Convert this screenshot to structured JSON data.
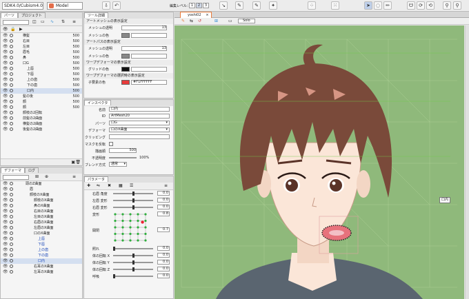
{
  "toolbar": {
    "app_select": "SDK4.0/Cubism4.0",
    "mode_select": "Model",
    "edit_level_label": "編集レベル：",
    "levels": [
      "1",
      "2",
      "3"
    ]
  },
  "left_top": {
    "tabs": [
      "パーツ",
      "プロジェクト"
    ],
    "rows": [
      {
        "label": "横髪",
        "value": "500",
        "indent": 10
      },
      {
        "label": "右目",
        "value": "500",
        "indent": 10
      },
      {
        "label": "左目",
        "value": "500",
        "indent": 10
      },
      {
        "label": "眉毛",
        "value": "500",
        "indent": 10
      },
      {
        "label": "鼻",
        "value": "500",
        "indent": 10
      },
      {
        "label": "口G",
        "value": "500",
        "indent": 10
      },
      {
        "label": "上唇",
        "value": "500",
        "indent": 16
      },
      {
        "label": "下唇",
        "value": "500",
        "indent": 16
      },
      {
        "label": "上の歯",
        "value": "500",
        "indent": 16
      },
      {
        "label": "下の歯",
        "value": "500",
        "indent": 16
      },
      {
        "label": "口内",
        "value": "500",
        "indent": 16,
        "selected": true
      },
      {
        "label": "髪の後",
        "value": "500",
        "indent": 10
      },
      {
        "label": "顔",
        "value": "500",
        "indent": 10
      },
      {
        "label": "顔",
        "value": "500",
        "indent": 10
      },
      {
        "label": "顔枝の2回転",
        "value": "",
        "indent": 10
      },
      {
        "label": "前髪の2曲面",
        "value": "",
        "indent": 10
      },
      {
        "label": "横髪の2曲面",
        "value": "",
        "indent": 10
      },
      {
        "label": "後髪の2曲面",
        "value": "",
        "indent": 10
      }
    ]
  },
  "left_bottom": {
    "tabs": [
      "デフォーマ",
      "ログ"
    ],
    "rows": [
      {
        "label": "頭のZ曲面",
        "indent": 14
      },
      {
        "label": "眉",
        "indent": 20
      },
      {
        "label": "顔枝のX曲面",
        "indent": 20
      },
      {
        "label": "顔枝のX曲面",
        "indent": 26
      },
      {
        "label": "鼻のX曲面",
        "indent": 26
      },
      {
        "label": "右目のX曲面",
        "indent": 26
      },
      {
        "label": "左目のX曲面",
        "indent": 26
      },
      {
        "label": "右眉のX曲面",
        "indent": 26
      },
      {
        "label": "左眉のX曲面",
        "indent": 26
      },
      {
        "label": "口のX曲面",
        "indent": 26
      },
      {
        "label": "上唇",
        "indent": 32,
        "blue": true
      },
      {
        "label": "下唇",
        "indent": 32,
        "blue": true
      },
      {
        "label": "上の歯",
        "indent": 32,
        "blue": true
      },
      {
        "label": "下の歯",
        "indent": 32,
        "blue": true
      },
      {
        "label": "口内",
        "indent": 32,
        "blue": true,
        "selected": true
      },
      {
        "label": "右耳のX曲面",
        "indent": 26
      },
      {
        "label": "左耳のX曲面",
        "indent": 26
      }
    ]
  },
  "tool_details": {
    "tab": "ツール詳細",
    "section1": "アートメッシュの表示設定",
    "mesh_opacity_label": "メッシュの透明",
    "mesh_opacity_value": "13",
    "mesh_color_label": "メッシュの色",
    "section2": "アートパスの表示設定",
    "path_opacity_label": "メッシュの透明",
    "path_opacity_value": "13",
    "path_color_label": "メッシュの色",
    "section3": "ワープデフォーマの表示設定",
    "grid_color_label": "グリッドの色",
    "section4": "ワープデフォーマの選択時の表示設定",
    "child_color_label": "子要素の色",
    "child_color_value": "#F1FFFFFF"
  },
  "inspector": {
    "tab": "インスペクタ",
    "name_label": "名前",
    "name_value": "口内",
    "id_label": "ID",
    "id_value": "ArtMesh20",
    "parts_label": "パーツ",
    "parts_value": "口G",
    "deformer_label": "デフォーマ",
    "deformer_value": "口のX曲面",
    "clipping_label": "クリッピング",
    "clipping_value": "",
    "mask_label": "マスクを反転",
    "draw_order_label": "描画順",
    "draw_order_value": "500",
    "opacity_label": "不透明度",
    "opacity_value": "100%",
    "blend_label": "ブレンド方式",
    "blend_value": "通常"
  },
  "parameters": {
    "tab": "パラメータ",
    "items": [
      {
        "name": "右眉 角度",
        "value": "0.0",
        "pos": 0.5
      },
      {
        "name": "左眉 変形",
        "value": "0.0",
        "pos": 0.5
      },
      {
        "name": "右眉 変形",
        "value": "0.0",
        "pos": 0.5
      },
      {
        "name": "変形",
        "value": "0.8",
        "pos": 0.9
      },
      {
        "name": "開閉",
        "value": "0.7",
        "pos": 0.7
      },
      {
        "name": "照れ",
        "value": "0.0",
        "pos": 0.0
      },
      {
        "name": "体の回転 X",
        "value": "0.0",
        "pos": 0.5
      },
      {
        "name": "体の回転 Y",
        "value": "0.0",
        "pos": 0.5
      },
      {
        "name": "体の回転 Z",
        "value": "0.0",
        "pos": 0.5
      },
      {
        "name": "呼吸",
        "value": "0.0",
        "pos": 0.0
      }
    ]
  },
  "canvas": {
    "tab": "yoshi02",
    "solo_label": "Solo",
    "tooltip": "口内",
    "bg_color": "#8fb97b",
    "hair_color": "#7a4a3a",
    "skin_color": "#fbe6d8"
  }
}
